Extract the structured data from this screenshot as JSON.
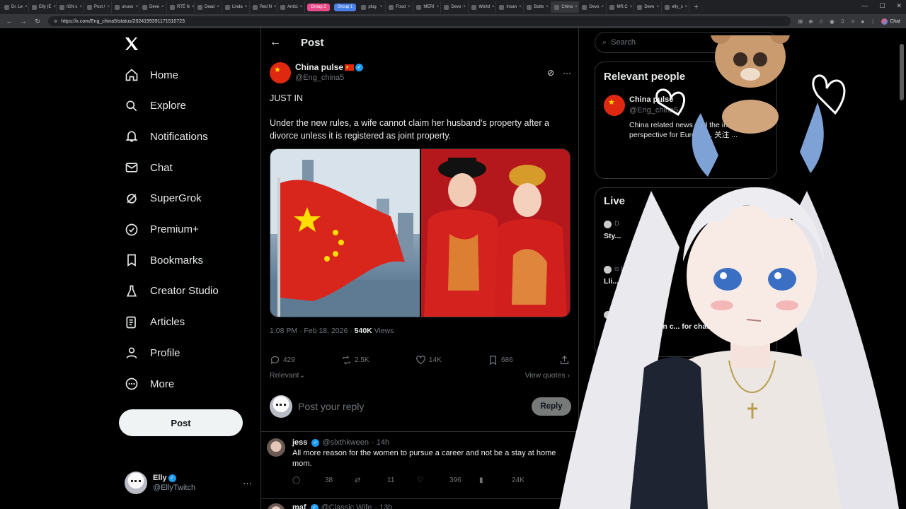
{
  "browser": {
    "tabs": [
      "Dr. Le",
      "Elly (E",
      "IGN c",
      "Post /",
      "unuso",
      "Deve",
      "RTÉ N",
      "Dead",
      "Linda",
      "Red N",
      "Antici",
      "Group 2",
      "Group 1",
      "plug",
      "Food",
      "MERI",
      "Devo",
      "World",
      "Insan",
      "Butte",
      "China",
      "Devo",
      "MR.C",
      "Deve",
      "elly_s"
    ],
    "group_labels": [
      "Group 2",
      "Group 1"
    ],
    "group_colors": [
      "#e84a8a",
      "#4a7fe8"
    ],
    "url": "https://x.com/Eng_china5/status/2024199391171510723",
    "chat_label": "Chat"
  },
  "sidebar": {
    "logo": "X",
    "items": [
      {
        "label": "Home",
        "icon": "home-icon"
      },
      {
        "label": "Explore",
        "icon": "search-icon"
      },
      {
        "label": "Notifications",
        "icon": "bell-icon"
      },
      {
        "label": "Chat",
        "icon": "mail-icon"
      },
      {
        "label": "SuperGrok",
        "icon": "grok-icon"
      },
      {
        "label": "Premium+",
        "icon": "verified-badge-icon"
      },
      {
        "label": "Bookmarks",
        "icon": "bookmark-icon"
      },
      {
        "label": "Creator Studio",
        "icon": "flask-icon"
      },
      {
        "label": "Articles",
        "icon": "article-icon"
      },
      {
        "label": "Profile",
        "icon": "person-icon"
      },
      {
        "label": "More",
        "icon": "more-circle-icon"
      }
    ],
    "post_button": "Post",
    "account": {
      "name": "Elly",
      "handle": "@EllyTwitch",
      "more": "···"
    }
  },
  "post": {
    "header_title": "Post",
    "author_name": "China pulse",
    "author_handle": "@Eng_china5",
    "line1": "JUST IN",
    "line2": "Under the new rules, a wife cannot claim her husband's property after a divorce unless it is registered as joint property.",
    "time": "1:08 PM · Feb 18, 2026 · ",
    "views_count": "540K",
    "views_label": " Views",
    "stats": {
      "replies": "429",
      "reposts": "2.5K",
      "likes": "14K",
      "bookmarks": "686"
    },
    "sort_label": "Relevant",
    "view_quotes": "View quotes ›",
    "reply_placeholder": "Post your reply",
    "reply_button": "Reply"
  },
  "replies": [
    {
      "name": "jess",
      "handle": "@slxthkween",
      "time": "· 14h",
      "text": "All more reason for the women to pursue a career and not be a stay at home mom.",
      "stats": {
        "replies": "38",
        "reposts": "11",
        "likes": "396",
        "views": "24K"
      }
    },
    {
      "name": "maf",
      "handle": "@Classic Wife",
      "time": "· 13h",
      "text": "",
      "stats": {
        "replies": "",
        "reposts": "",
        "likes": "",
        "views": ""
      }
    }
  ],
  "right": {
    "search_placeholder": "Search",
    "relevant_title": "Relevant people",
    "rel_name": "China pulse",
    "rel_handle": "@Eng_china5",
    "rel_bio": "China related news and the international perspective for Europe ... 关注 ...",
    "live_title": "Live",
    "live": [
      {
        "host": "D",
        "title": "Sty..."
      },
      {
        "host": "is hosting",
        "title": "Lli... Mueri on T..."
      },
      {
        "host": "is hosting",
        "title": "...e oni illustration c... for chatting <3"
      }
    ]
  }
}
